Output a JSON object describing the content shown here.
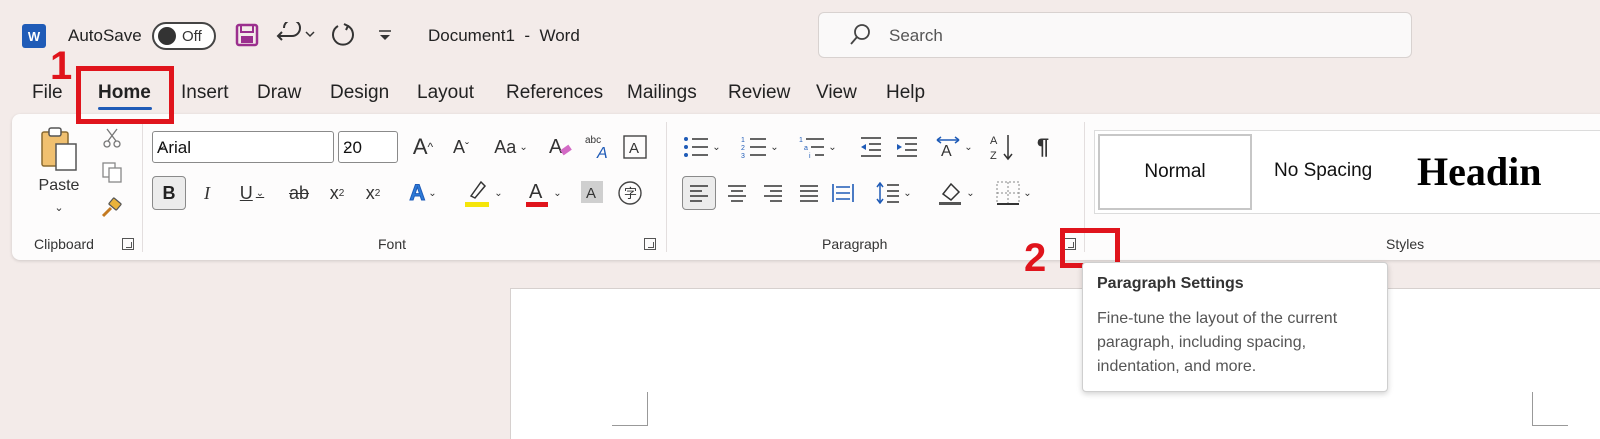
{
  "titlebar": {
    "app_icon": "W",
    "autosave_label": "AutoSave",
    "autosave_state": "Off",
    "document_title": "Document1  -  Word",
    "search_placeholder": "Search"
  },
  "tabs": [
    {
      "label": "File"
    },
    {
      "label": "Home",
      "active": true
    },
    {
      "label": "Insert"
    },
    {
      "label": "Draw"
    },
    {
      "label": "Design"
    },
    {
      "label": "Layout"
    },
    {
      "label": "References"
    },
    {
      "label": "Mailings"
    },
    {
      "label": "Review"
    },
    {
      "label": "View"
    },
    {
      "label": "Help"
    }
  ],
  "ribbon": {
    "clipboard": {
      "label": "Clipboard",
      "paste_label": "Paste"
    },
    "font": {
      "label": "Font",
      "font_name": "Arial",
      "font_size": "20"
    },
    "paragraph": {
      "label": "Paragraph"
    },
    "styles": {
      "label": "Styles",
      "items": [
        "Normal",
        "No Spacing",
        "Headin"
      ]
    }
  },
  "annotations": {
    "one": "1",
    "two": "2",
    "color": "#e0141c"
  },
  "tooltip": {
    "title": "Paragraph Settings",
    "body": "Fine-tune the layout of the current paragraph, including spacing, indentation, and more."
  },
  "colors": {
    "accent": "#1f5bb7",
    "background": "#f3ebe9",
    "highlight_yellow": "#f5e50a",
    "font_red": "#e0141c"
  }
}
